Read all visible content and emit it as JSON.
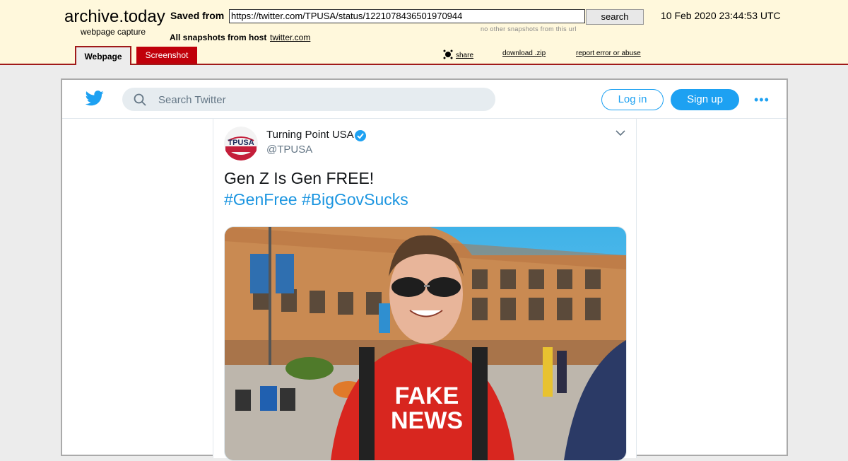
{
  "archive": {
    "brand": "archive.today",
    "subtitle": "webpage capture",
    "saved_from_label": "Saved from",
    "url": "https://twitter.com/TPUSA/status/1221078436501970944",
    "search_label": "search",
    "no_other": "no other snapshots from this url",
    "datetime": "10 Feb 2020 23:44:53 UTC",
    "all_snapshots": "All snapshots  from host",
    "host": "twitter.com",
    "tabs": [
      "Webpage",
      "Screenshot"
    ],
    "links": {
      "share": "share",
      "download": "download .zip",
      "report": "report error or abuse"
    }
  },
  "twitter": {
    "search_placeholder": "Search Twitter",
    "login": "Log in",
    "signup": "Sign up",
    "more": "•••",
    "tweet": {
      "display_name": "Turning Point USA",
      "handle": "@TPUSA",
      "avatar_text": "TPUSA",
      "text_line1": "Gen Z Is Gen FREE!",
      "hashtags": "#GenFree #BigGovSucks",
      "shirt_text": [
        "FAKE",
        "NEWS"
      ]
    }
  },
  "colors": {
    "twitter_blue": "#1da1f2",
    "archive_red": "#a01a1a",
    "archive_bg": "#fff8dc"
  }
}
